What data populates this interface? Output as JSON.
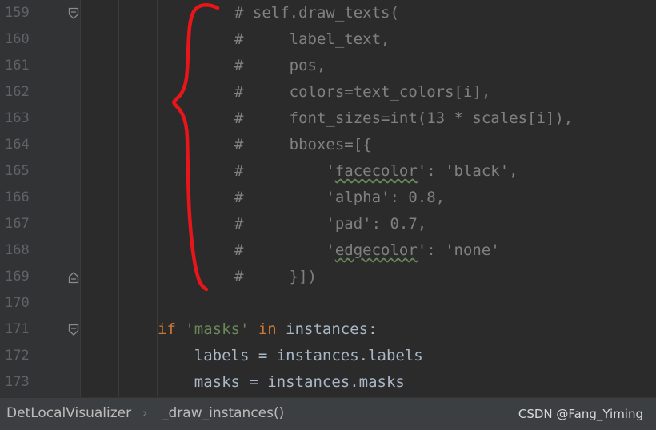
{
  "editor": {
    "lines": [
      {
        "number": "159",
        "fold": "start",
        "segments": [
          {
            "t": "# self.draw_texts(",
            "c": "cm"
          }
        ]
      },
      {
        "number": "160",
        "fold": "",
        "segments": [
          {
            "t": "#     label_text,",
            "c": "cm"
          }
        ]
      },
      {
        "number": "161",
        "fold": "",
        "segments": [
          {
            "t": "#     pos,",
            "c": "cm"
          }
        ]
      },
      {
        "number": "162",
        "fold": "",
        "segments": [
          {
            "t": "#     colors=text_colors[i],",
            "c": "cm"
          }
        ]
      },
      {
        "number": "163",
        "fold": "",
        "segments": [
          {
            "t": "#     font_sizes=int(13 * scales[i]),",
            "c": "cm"
          }
        ]
      },
      {
        "number": "164",
        "fold": "",
        "segments": [
          {
            "t": "#     bboxes=[{",
            "c": "cm"
          }
        ]
      },
      {
        "number": "165",
        "fold": "",
        "segments": [
          {
            "t": "#         '",
            "c": "cm"
          },
          {
            "t": "facecolor",
            "c": "cm wavy"
          },
          {
            "t": "': 'black',",
            "c": "cm"
          }
        ]
      },
      {
        "number": "166",
        "fold": "",
        "segments": [
          {
            "t": "#         'alpha': 0.8,",
            "c": "cm"
          }
        ]
      },
      {
        "number": "167",
        "fold": "",
        "segments": [
          {
            "t": "#         'pad': 0.7,",
            "c": "cm"
          }
        ]
      },
      {
        "number": "168",
        "fold": "",
        "segments": [
          {
            "t": "#         '",
            "c": "cm"
          },
          {
            "t": "edgecolor",
            "c": "cm wavy"
          },
          {
            "t": "': 'none'",
            "c": "cm"
          }
        ]
      },
      {
        "number": "169",
        "fold": "end",
        "segments": [
          {
            "t": "#     }])",
            "c": "cm"
          }
        ]
      },
      {
        "number": "170",
        "fold": "",
        "segments": []
      },
      {
        "number": "171",
        "fold": "start",
        "segments": [
          {
            "t": "if ",
            "c": "kw"
          },
          {
            "t": "'masks'",
            "c": "str"
          },
          {
            "t": " in ",
            "c": "kw"
          },
          {
            "t": "instances:",
            "c": "id"
          }
        ]
      },
      {
        "number": "172",
        "fold": "",
        "segments": [
          {
            "t": "    labels = instances.labels",
            "c": "id"
          }
        ]
      },
      {
        "number": "173",
        "fold": "",
        "segments": [
          {
            "t": "    masks = instances.masks",
            "c": "id"
          }
        ]
      }
    ]
  },
  "breadcrumb": {
    "class_name": "DetLocalVisualizer",
    "separator": "›",
    "method_name": "_draw_instances()"
  },
  "watermark": "CSDN @Fang_Yiming",
  "colors": {
    "background": "#2b2b2b",
    "gutter": "#313335",
    "line_number": "#606366",
    "comment": "#808080",
    "keyword": "#cc7832",
    "string": "#6a8759",
    "identifier": "#a9b7c6",
    "statusbar": "#3c3f41",
    "annotation": "#e8151b"
  }
}
